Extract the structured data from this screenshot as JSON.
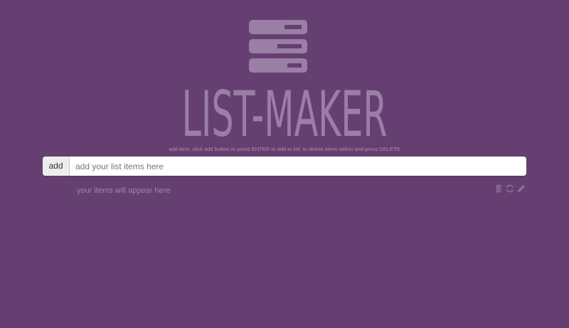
{
  "app": {
    "title": "LIST-MAKER",
    "instructions": "add item, click add button or press ENTER to add to list. to delete items select and press DELETE"
  },
  "input_row": {
    "add_label": "add",
    "placeholder": "add your list items here",
    "value": ""
  },
  "list": {
    "empty_text": "your items will appear here"
  },
  "toolbar": {
    "icons": [
      "trash-icon",
      "refresh-icon",
      "pencil-icon"
    ]
  },
  "colors": {
    "background": "#663f72",
    "logo": "#9a7ea6",
    "muted_text": "#9b86a6"
  }
}
